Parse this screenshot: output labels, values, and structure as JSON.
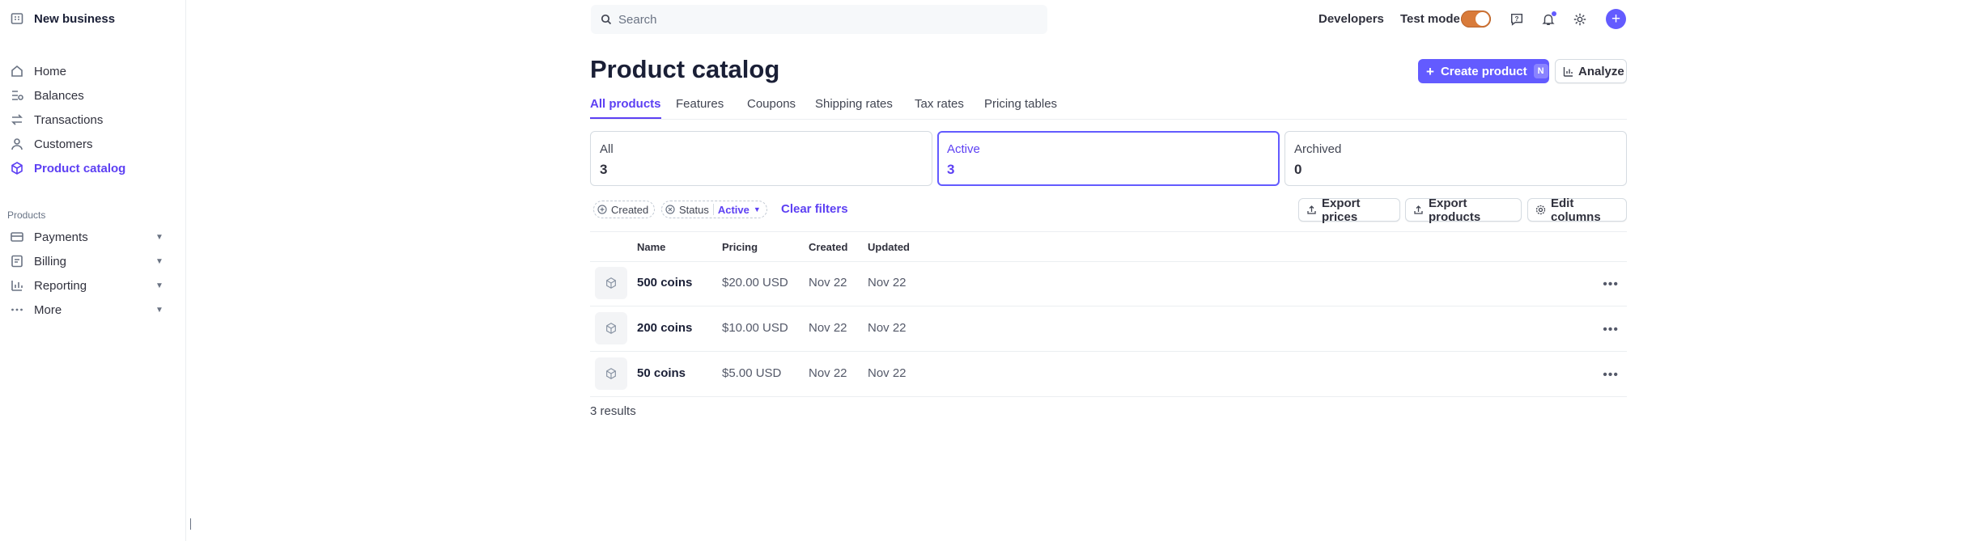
{
  "sidebar": {
    "business_name": "New business",
    "items": [
      {
        "label": "Home",
        "icon": "home-icon"
      },
      {
        "label": "Balances",
        "icon": "balances-icon"
      },
      {
        "label": "Transactions",
        "icon": "transactions-icon"
      },
      {
        "label": "Customers",
        "icon": "customers-icon"
      },
      {
        "label": "Product catalog",
        "icon": "product-catalog-icon",
        "active": true
      }
    ],
    "section_label": "Products",
    "product_items": [
      {
        "label": "Payments",
        "icon": "payments-icon"
      },
      {
        "label": "Billing",
        "icon": "billing-icon"
      },
      {
        "label": "Reporting",
        "icon": "reporting-icon"
      },
      {
        "label": "More",
        "icon": "more-dots-icon"
      }
    ]
  },
  "topbar": {
    "search_placeholder": "Search",
    "developers_label": "Developers",
    "test_mode_label": "Test mode",
    "test_mode_on": true,
    "accent": "#635bff",
    "toggle_color": "#d97b3a"
  },
  "page": {
    "title": "Product catalog",
    "create_label": "Create product",
    "create_shortcut": "N",
    "analyze_label": "Analyze",
    "tabs": [
      "All products",
      "Features",
      "Coupons",
      "Shipping rates",
      "Tax rates",
      "Pricing tables"
    ],
    "active_tab": "All products"
  },
  "stats": [
    {
      "label": "All",
      "value": "3"
    },
    {
      "label": "Active",
      "value": "3",
      "active": true
    },
    {
      "label": "Archived",
      "value": "0"
    }
  ],
  "filters": {
    "created_label": "Created",
    "status_label": "Status",
    "status_value": "Active",
    "clear_label": "Clear filters",
    "export_prices": "Export prices",
    "export_products": "Export products",
    "edit_columns": "Edit columns"
  },
  "table": {
    "columns": [
      "Name",
      "Pricing",
      "Created",
      "Updated"
    ],
    "rows": [
      {
        "name": "500 coins",
        "pricing": "$20.00 USD",
        "created": "Nov 22",
        "updated": "Nov 22"
      },
      {
        "name": "200 coins",
        "pricing": "$10.00 USD",
        "created": "Nov 22",
        "updated": "Nov 22"
      },
      {
        "name": "50 coins",
        "pricing": "$5.00 USD",
        "created": "Nov 22",
        "updated": "Nov 22"
      }
    ],
    "results_text": "3 results"
  }
}
